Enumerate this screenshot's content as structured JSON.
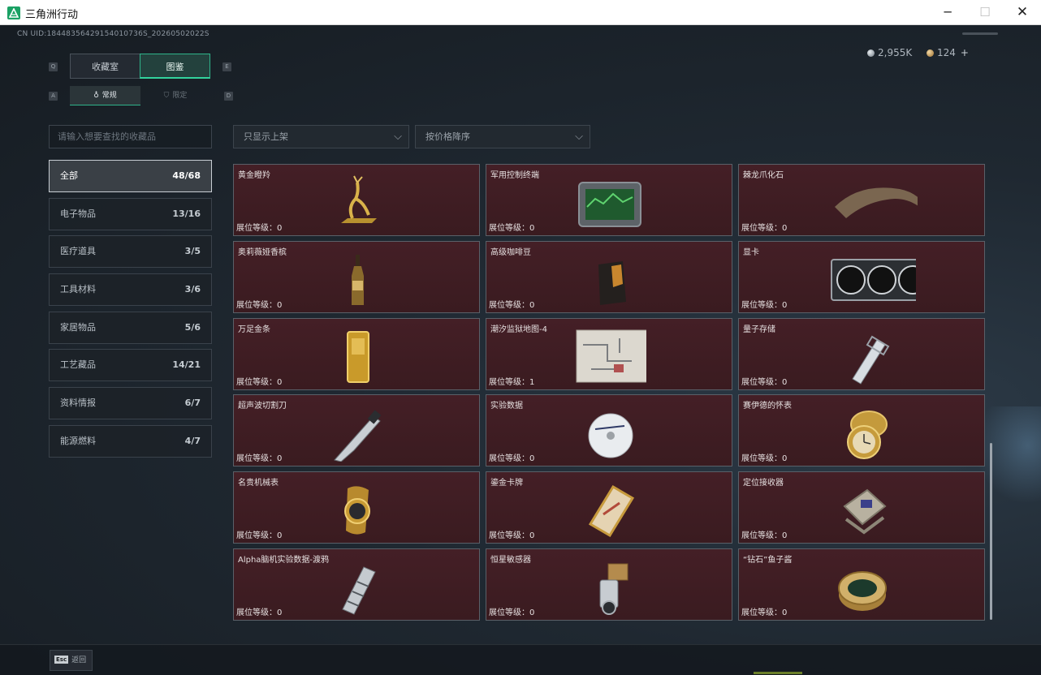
{
  "window": {
    "title": "三角洲行动",
    "minimize_icon": "─",
    "maximize_icon": "☐",
    "close_icon": "✕"
  },
  "header": {
    "uid": "CN UID:18448356429154010736S_20260502022S",
    "currency_silver": "2,955K",
    "currency_gold": "124",
    "plus": "+"
  },
  "tabs": {
    "left_key": "Q",
    "right_key": "E",
    "items": [
      {
        "label": "收藏室"
      },
      {
        "label": "图鉴"
      }
    ],
    "sub_left_key": "A",
    "sub_right_key": "D",
    "subtabs": [
      {
        "label": "常规",
        "icon": "♁"
      },
      {
        "label": "限定",
        "icon": "⛉"
      }
    ]
  },
  "search": {
    "placeholder": "请输入想要查找的收藏品"
  },
  "filters": {
    "shelf": "只显示上架",
    "sort": "按价格降序",
    "arrow": "⌵"
  },
  "categories": [
    {
      "label": "全部",
      "count": "48/68"
    },
    {
      "label": "电子物品",
      "count": "13/16"
    },
    {
      "label": "医疗道具",
      "count": "3/5"
    },
    {
      "label": "工具材料",
      "count": "3/6"
    },
    {
      "label": "家居物品",
      "count": "5/6"
    },
    {
      "label": "工艺藏品",
      "count": "14/21"
    },
    {
      "label": "资料情报",
      "count": "6/7"
    },
    {
      "label": "能源燃料",
      "count": "4/7"
    }
  ],
  "items": [
    {
      "name": "黄金瞪羚",
      "level": "展位等级：0",
      "icon": "gold-gazelle"
    },
    {
      "name": "军用控制终端",
      "level": "展位等级：0",
      "icon": "military-terminal"
    },
    {
      "name": "棘龙爪化石",
      "level": "展位等级：0",
      "icon": "claw-fossil"
    },
    {
      "name": "奥莉薇娅香槟",
      "level": "展位等级：0",
      "icon": "champagne"
    },
    {
      "name": "高级咖啡豆",
      "level": "展位等级：0",
      "icon": "coffee-bag"
    },
    {
      "name": "显卡",
      "level": "展位等级：0",
      "icon": "graphics-card"
    },
    {
      "name": "万足金条",
      "level": "展位等级：0",
      "icon": "gold-bar"
    },
    {
      "name": "潮汐监狱地图-4",
      "level": "展位等级：1",
      "icon": "map"
    },
    {
      "name": "量子存储",
      "level": "展位等级：0",
      "icon": "quantum-storage"
    },
    {
      "name": "超声波切割刀",
      "level": "展位等级：0",
      "icon": "ultrasonic-knife"
    },
    {
      "name": "实验数据",
      "level": "展位等级：0",
      "icon": "data-disc"
    },
    {
      "name": "赛伊德的怀表",
      "level": "展位等级：0",
      "icon": "pocket-watch"
    },
    {
      "name": "名贵机械表",
      "level": "展位等级：0",
      "icon": "wrist-watch"
    },
    {
      "name": "鎏金卡牌",
      "level": "展位等级：0",
      "icon": "gilded-card"
    },
    {
      "name": "定位接收器",
      "level": "展位等级：0",
      "icon": "locator-receiver"
    },
    {
      "name": "Alpha脑机实验数据-渡鸦",
      "level": "展位等级：0",
      "icon": "alpha-data-canister"
    },
    {
      "name": "恒星敏感器",
      "level": "展位等级：0",
      "icon": "star-sensor"
    },
    {
      "name": "“钻石”鱼子酱",
      "level": "展位等级：0",
      "icon": "caviar-tin"
    }
  ],
  "footer": {
    "esc_key": "Esc",
    "esc_label": "返回"
  },
  "colors": {
    "accent": "#32d39d",
    "card_bg": "#3f1c22",
    "page_bg": "#1b2128"
  }
}
